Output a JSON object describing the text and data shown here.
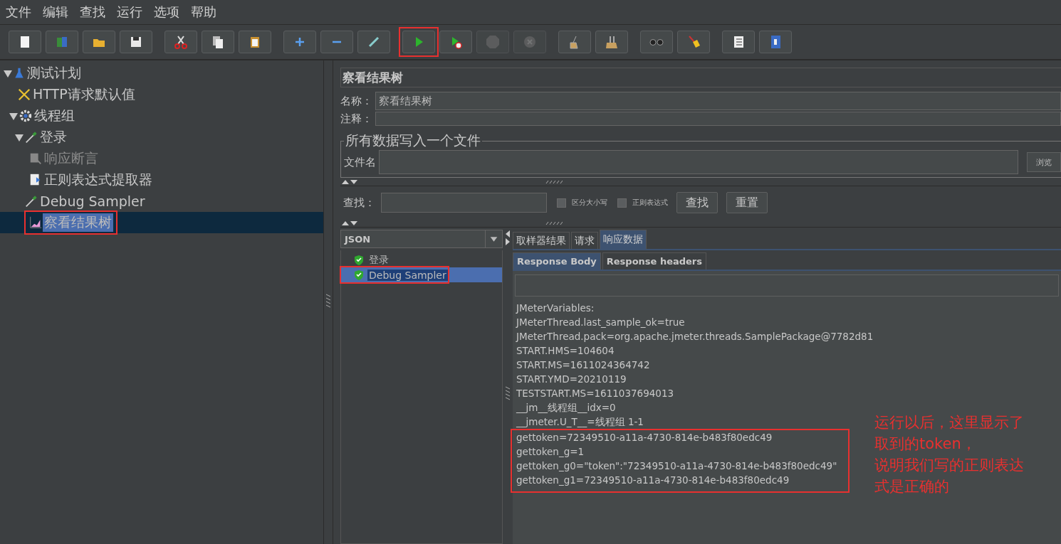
{
  "menu": [
    "文件",
    "编辑",
    "查找",
    "运行",
    "选项",
    "帮助"
  ],
  "toolbar": [
    {
      "kind": "new",
      "disabled": false,
      "annotated": false
    },
    {
      "kind": "templates",
      "disabled": false,
      "annotated": false
    },
    {
      "kind": "open",
      "disabled": false,
      "annotated": false
    },
    {
      "kind": "save",
      "disabled": false,
      "annotated": false
    },
    {
      "kind": "cut",
      "disabled": false,
      "annotated": false
    },
    {
      "kind": "copy",
      "disabled": false,
      "annotated": false
    },
    {
      "kind": "paste",
      "disabled": false,
      "annotated": false
    },
    {
      "kind": "expand",
      "disabled": false,
      "annotated": false
    },
    {
      "kind": "collapse",
      "disabled": false,
      "annotated": false
    },
    {
      "kind": "toggle",
      "disabled": false,
      "annotated": false
    },
    {
      "kind": "start",
      "disabled": false,
      "annotated": true
    },
    {
      "kind": "start-no-pause",
      "disabled": false,
      "annotated": false
    },
    {
      "kind": "stop",
      "disabled": true,
      "annotated": false
    },
    {
      "kind": "shutdown",
      "disabled": true,
      "annotated": false
    },
    {
      "kind": "clear",
      "disabled": false,
      "annotated": false
    },
    {
      "kind": "clear-all",
      "disabled": false,
      "annotated": false
    },
    {
      "kind": "search",
      "disabled": false,
      "annotated": false
    },
    {
      "kind": "reset-search",
      "disabled": false,
      "annotated": false
    },
    {
      "kind": "function-helper",
      "disabled": false,
      "annotated": false
    },
    {
      "kind": "help",
      "disabled": false,
      "annotated": false
    }
  ],
  "tree": [
    {
      "label": "测试计划",
      "kind": "test-plan",
      "expanded": true,
      "selected": false,
      "disabled": false,
      "annotated": false,
      "children": [
        {
          "label": "HTTP请求默认值",
          "kind": "config",
          "selected": false,
          "disabled": false,
          "annotated": false
        },
        {
          "label": "线程组",
          "kind": "thread-group",
          "expanded": true,
          "selected": false,
          "disabled": false,
          "annotated": false,
          "children": [
            {
              "label": "登录",
              "kind": "sampler",
              "expanded": true,
              "selected": false,
              "disabled": false,
              "annotated": false,
              "children": [
                {
                  "label": "响应断言",
                  "kind": "assertion",
                  "selected": false,
                  "disabled": true,
                  "annotated": false
                },
                {
                  "label": "正则表达式提取器",
                  "kind": "extractor",
                  "selected": false,
                  "disabled": false,
                  "annotated": false
                }
              ]
            },
            {
              "label": "Debug Sampler",
              "kind": "sampler",
              "selected": false,
              "disabled": false,
              "annotated": false
            },
            {
              "label": "察看结果树",
              "kind": "listener",
              "selected": true,
              "disabled": false,
              "annotated": true
            }
          ]
        }
      ]
    }
  ],
  "panel": {
    "title": "察看结果树",
    "name_label": "名称：",
    "name_value": "察看结果树",
    "comment_label": "注释：",
    "file_group": {
      "legend": "所有数据写入一个文件",
      "file_label": "文件名",
      "browse_button": "浏览"
    },
    "search": {
      "label": "查找：",
      "case_checkbox": {
        "label": "区分大小写",
        "checked": false
      },
      "regex_checkbox": {
        "label": "正则表达式",
        "checked": false
      },
      "find_button": "查找",
      "reset_button": "重置"
    },
    "renderer": "JSON",
    "results": [
      {
        "label": "登录",
        "selected": false,
        "annotated": false
      },
      {
        "label": "Debug Sampler",
        "selected": true,
        "annotated": true
      }
    ],
    "tabs": [
      {
        "label": "取样器结果",
        "selected": false
      },
      {
        "label": "请求",
        "selected": false
      },
      {
        "label": "响应数据",
        "selected": true
      }
    ],
    "subtabs": [
      {
        "label": "Response Body",
        "selected": true
      },
      {
        "label": "Response headers",
        "selected": false
      }
    ],
    "lines": [
      "JMeterVariables:",
      "JMeterThread.last_sample_ok=true",
      "JMeterThread.pack=org.apache.jmeter.threads.SamplePackage@7782d81",
      "START.HMS=104604",
      "START.MS=1611024364742",
      "START.YMD=20210119",
      "TESTSTART.MS=1611037694013",
      "__jm__线程组__idx=0",
      "__jmeter.U_T__=线程组 1-1"
    ],
    "highlighted_lines": [
      "gettoken=72349510-a11a-4730-814e-b483f80edc49",
      "gettoken_g=1",
      "gettoken_g0=\"token\":\"72349510-a11a-4730-814e-b483f80edc49\"",
      "gettoken_g1=72349510-a11a-4730-814e-b483f80edc49"
    ],
    "note": [
      "运行以后，这里显示了",
      "取到的token，",
      "说明我们写的正则表达",
      "式是正确的"
    ]
  }
}
